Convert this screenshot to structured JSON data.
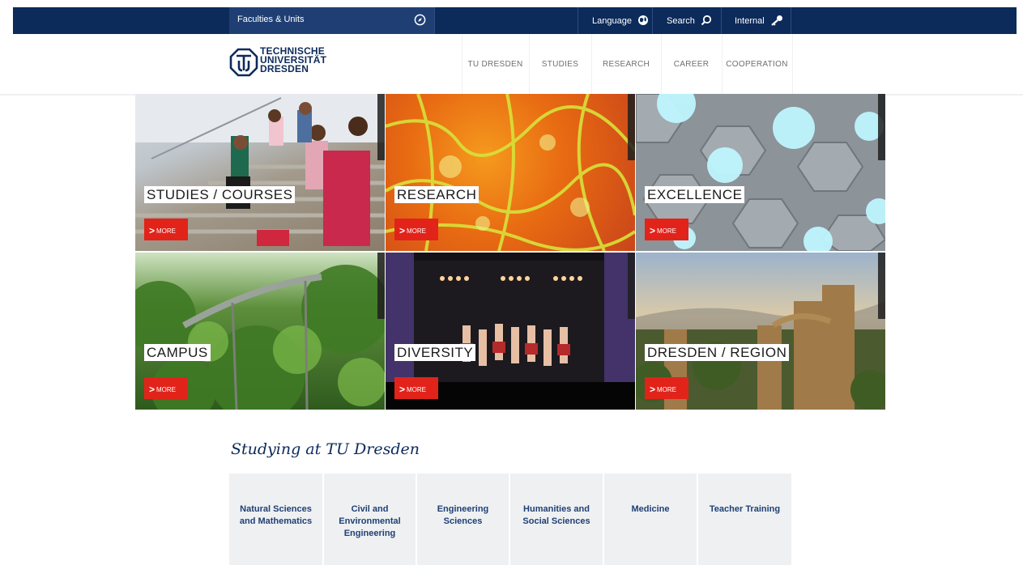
{
  "topbar": {
    "faculties_label": "Faculties & Units",
    "language_label": "Language",
    "search_label": "Search",
    "internal_label": "Internal"
  },
  "header": {
    "logo_lines": [
      "TECHNISCHE",
      "UNIVERSITÄT",
      "DRESDEN"
    ],
    "nav": [
      "TU DRESDEN",
      "STUDIES",
      "RESEARCH",
      "CAREER",
      "COOPERATION"
    ]
  },
  "tiles": [
    {
      "label": "STUDIES / COURSES",
      "more": "MORE"
    },
    {
      "label": "RESEARCH",
      "more": "MORE"
    },
    {
      "label": "EXCELLENCE",
      "more": "MORE"
    },
    {
      "label": "CAMPUS",
      "more": "MORE"
    },
    {
      "label": "DIVERSITY",
      "more": "MORE"
    },
    {
      "label": "DRESDEN / REGION",
      "more": "MORE"
    }
  ],
  "studying": {
    "title": "Studying at TU Dresden",
    "areas": [
      "Natural Sciences and Mathematics",
      "Civil and Environmental Engineering",
      "Engineering Sciences",
      "Humanities and Social Sciences",
      "Medicine",
      "Teacher Training"
    ]
  },
  "colors": {
    "navy": "#0c2a5a",
    "accent_red": "#e2231a",
    "box_grey": "#eef0f2"
  }
}
